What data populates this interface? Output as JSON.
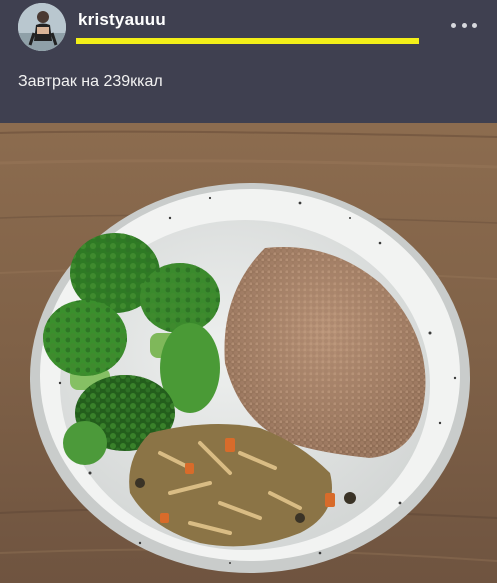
{
  "post": {
    "username": "kristyauuu",
    "caption": "Завтрак на 239ккал",
    "story_progress": 1.0,
    "more_icon": "more-horizontal-icon"
  },
  "photo": {
    "subject": "bowl of broccoli, buckwheat and stewed vegetables on wooden table"
  },
  "colors": {
    "header_bg": "#3f4050",
    "progress": "#f3f018",
    "text": "#ffffff"
  }
}
